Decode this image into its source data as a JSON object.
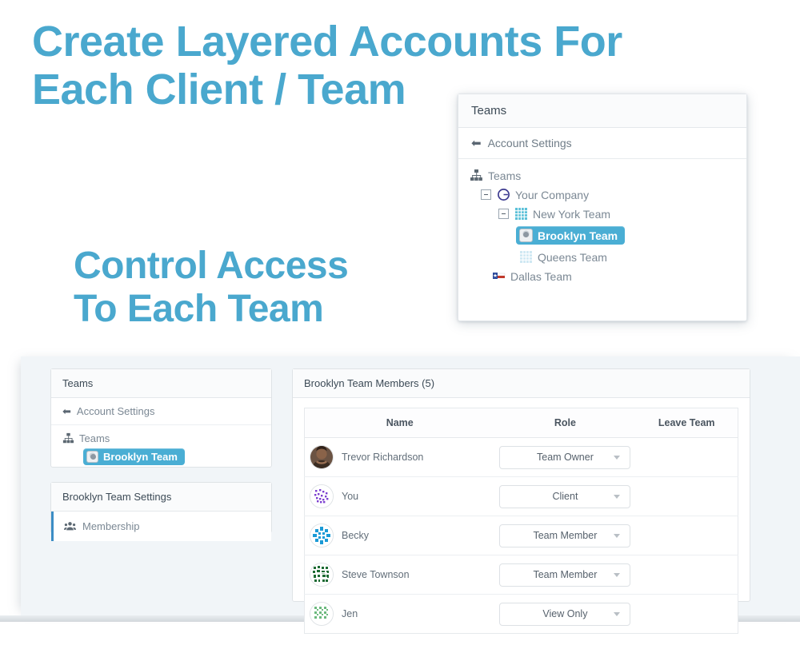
{
  "headlines": {
    "primary": "Create Layered Accounts For\nEach Client / Team",
    "secondary": "Control Access\nTo Each Team"
  },
  "colors": {
    "headline_blue": "#4aa8ce",
    "selected_node_bg": "#4aaed4",
    "accent_bar": "#3c8dc5",
    "band_background": "#f1f5f8"
  },
  "teams_panel_top": {
    "header": "Teams",
    "back_link": "Account Settings",
    "tree": {
      "root_label": "Teams",
      "root_icon": "sitemap-icon",
      "nodes": [
        {
          "label": "Your Company",
          "icon": "company-logo-icon",
          "level": 1,
          "expanded": true,
          "selected": false
        },
        {
          "label": "New York Team",
          "icon": "grid-pattern-icon",
          "level": 2,
          "expanded": true,
          "selected": false
        },
        {
          "label": "Brooklyn Team",
          "icon": "avatar-placeholder-icon",
          "level": 3,
          "expanded": false,
          "selected": true
        },
        {
          "label": "Queens Team",
          "icon": "grid-pattern-light-icon",
          "level": 3,
          "expanded": false,
          "selected": false
        },
        {
          "label": "Dallas Team",
          "icon": "texas-flag-icon",
          "level": 2,
          "expanded": false,
          "selected": false
        }
      ]
    }
  },
  "teams_panel_bottom": {
    "header": "Teams",
    "back_link": "Account Settings",
    "tree": {
      "root_label": "Teams",
      "root_icon": "sitemap-icon",
      "selected_label": "Brooklyn Team"
    }
  },
  "settings_panel": {
    "header": "Brooklyn Team Settings",
    "items": [
      {
        "label": "Membership",
        "icon": "users-group-icon",
        "active": true
      }
    ]
  },
  "members_panel": {
    "header": "Brooklyn Team Members (5)",
    "columns": [
      "Name",
      "Role",
      "Leave Team"
    ],
    "rows": [
      {
        "name": "Trevor Richardson",
        "role": "Team Owner",
        "avatar": "photo-avatar",
        "leave": ""
      },
      {
        "name": "You",
        "role": "Client",
        "avatar": "identicon-purple",
        "leave": ""
      },
      {
        "name": "Becky",
        "role": "Team Member",
        "avatar": "identicon-blue",
        "leave": ""
      },
      {
        "name": "Steve Townson",
        "role": "Team Member",
        "avatar": "identicon-darkgreen",
        "leave": ""
      },
      {
        "name": "Jen",
        "role": "View Only",
        "avatar": "identicon-lightgreen",
        "leave": ""
      }
    ]
  }
}
